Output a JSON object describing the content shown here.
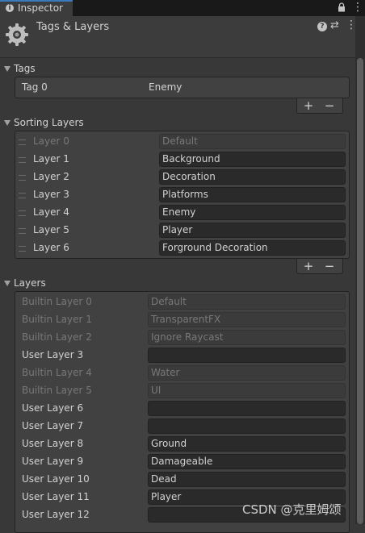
{
  "tab": {
    "label": "Inspector"
  },
  "header": {
    "title": "Tags & Layers"
  },
  "tags": {
    "title": "Tags",
    "items": [
      {
        "label": "Tag 0",
        "value": "Enemy"
      }
    ]
  },
  "sorting": {
    "title": "Sorting Layers",
    "items": [
      {
        "label": "Layer 0",
        "value": "Default",
        "locked": true
      },
      {
        "label": "Layer 1",
        "value": "Background"
      },
      {
        "label": "Layer 2",
        "value": "Decoration"
      },
      {
        "label": "Layer 3",
        "value": "Platforms"
      },
      {
        "label": "Layer 4",
        "value": "Enemy"
      },
      {
        "label": "Layer 5",
        "value": "Player"
      },
      {
        "label": "Layer 6",
        "value": "Forground Decoration"
      }
    ]
  },
  "layers": {
    "title": "Layers",
    "items": [
      {
        "label": "Builtin Layer 0",
        "value": "Default",
        "locked": true
      },
      {
        "label": "Builtin Layer 1",
        "value": "TransparentFX",
        "locked": true
      },
      {
        "label": "Builtin Layer 2",
        "value": "Ignore Raycast",
        "locked": true
      },
      {
        "label": "User Layer 3",
        "value": ""
      },
      {
        "label": "Builtin Layer 4",
        "value": "Water",
        "locked": true
      },
      {
        "label": "Builtin Layer 5",
        "value": "UI",
        "locked": true
      },
      {
        "label": "User Layer 6",
        "value": ""
      },
      {
        "label": "User Layer 7",
        "value": ""
      },
      {
        "label": "User Layer 8",
        "value": "Ground"
      },
      {
        "label": "User Layer 9",
        "value": "Damageable"
      },
      {
        "label": "User Layer 10",
        "value": "Dead"
      },
      {
        "label": "User Layer 11",
        "value": "Player"
      },
      {
        "label": "User Layer 12",
        "value": ""
      }
    ]
  },
  "buttons": {
    "add": "+",
    "remove": "−"
  },
  "watermark": "CSDN @克里姆颂"
}
